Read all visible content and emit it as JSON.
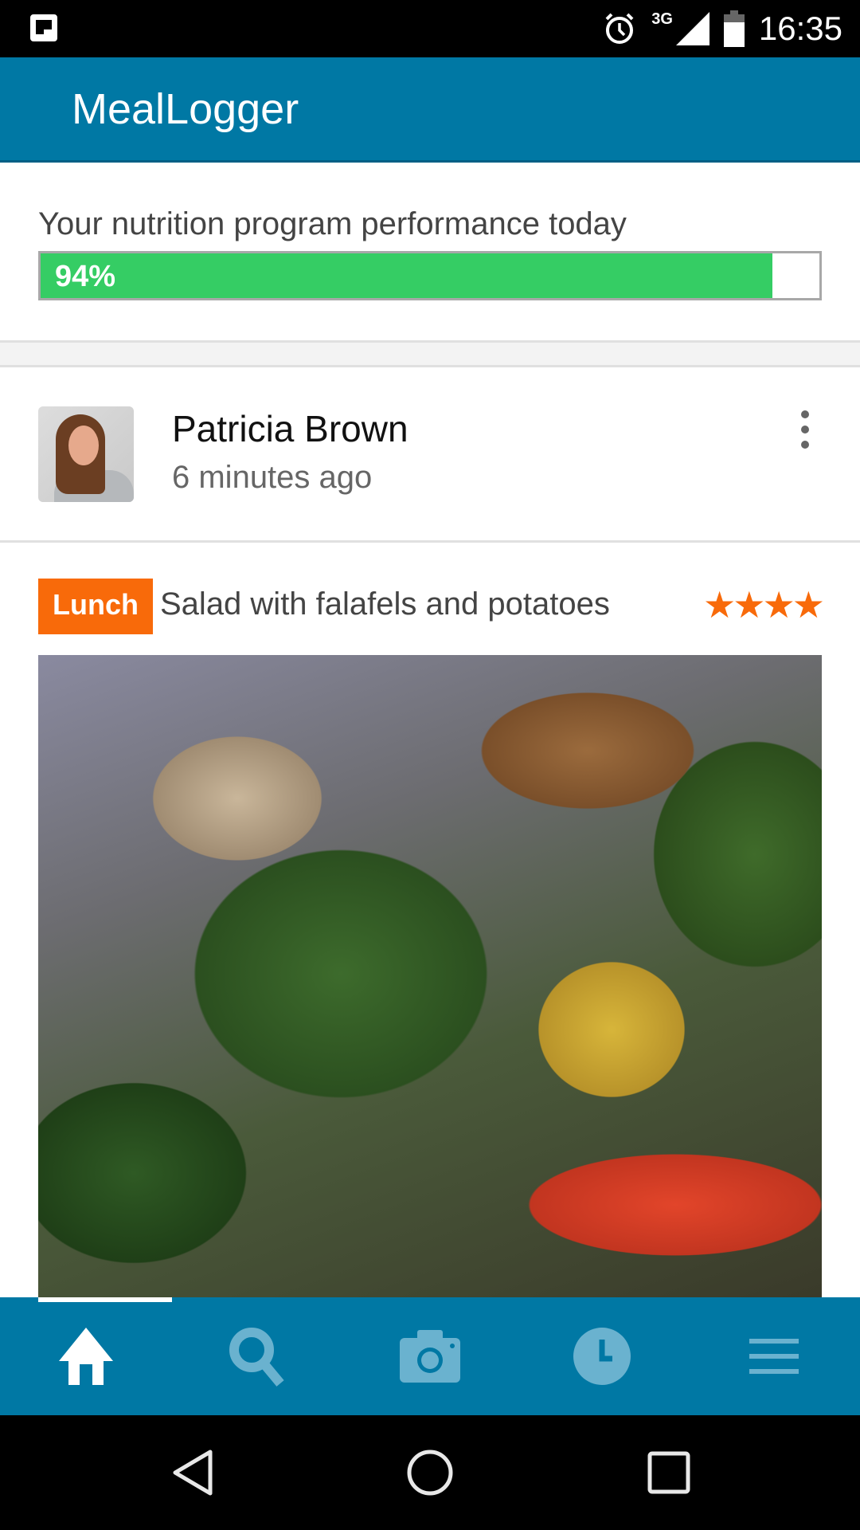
{
  "status_bar": {
    "time": "16:35",
    "network": "3G",
    "icons": [
      "notification-app-icon",
      "alarm-icon",
      "signal-icon",
      "battery-icon"
    ]
  },
  "app_bar": {
    "title": "MealLogger"
  },
  "performance": {
    "label": "Your nutrition program performance today",
    "percent_text": "94%",
    "value": 94,
    "fill_color": "#35cd64"
  },
  "post": {
    "user_name": "Patricia Brown",
    "time_ago": "6 minutes ago",
    "meal_type": "Lunch",
    "meal_title": "Salad with falafels and potatoes",
    "rating": 4,
    "rating_max": 4,
    "stars_text": "★★★★",
    "photo_alt": "Salad with zucchini, arugula, peppers, feta, falafels and potatoes"
  },
  "bottom_nav": {
    "items": [
      {
        "name": "home",
        "active": true
      },
      {
        "name": "search",
        "active": false
      },
      {
        "name": "camera",
        "active": false
      },
      {
        "name": "history",
        "active": false
      },
      {
        "name": "menu",
        "active": false
      }
    ]
  },
  "system_nav": {
    "buttons": [
      "back",
      "home",
      "recents"
    ]
  },
  "colors": {
    "primary": "#0078a4",
    "accent": "#f86a0a",
    "progress": "#35cd64",
    "nav_inactive": "#6ab2cf"
  }
}
